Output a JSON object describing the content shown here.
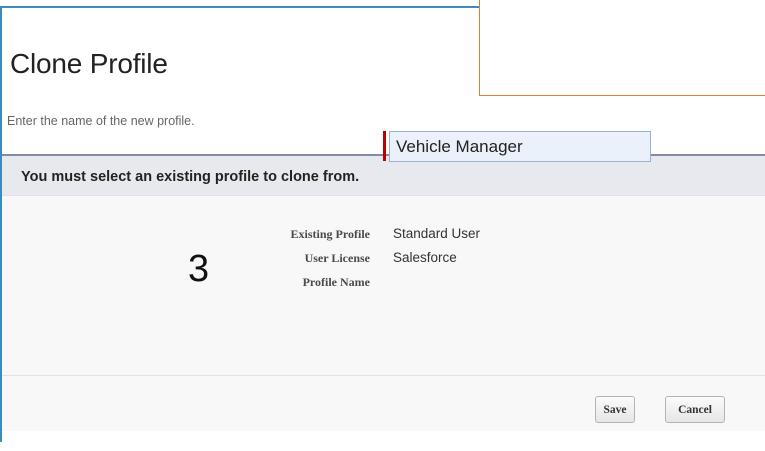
{
  "page": {
    "title": "Clone Profile",
    "subtitle": "Enter the name of the new profile."
  },
  "panel": {
    "header": "You must select an existing profile to clone from.",
    "step_number": "3",
    "fields": {
      "existing_profile_label": "Existing Profile",
      "existing_profile_value": "Standard User",
      "user_license_label": "User License",
      "user_license_value": "Salesforce",
      "profile_name_label": "Profile Name",
      "profile_name_value": "Vehicle Manager"
    }
  },
  "buttons": {
    "save": "Save",
    "cancel": "Cancel"
  },
  "colors": {
    "frame_border": "#3c8bb9",
    "callout_border": "#e07b3f",
    "required_marker": "#c00000",
    "header_bg": "#e8e9ef"
  }
}
